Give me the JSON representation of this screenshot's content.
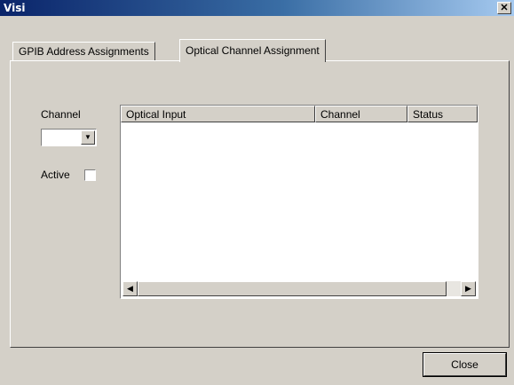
{
  "window": {
    "title": "Visi",
    "close_glyph": "✕"
  },
  "tabs": [
    {
      "label": "GPIB Address Assignments",
      "active": false
    },
    {
      "label": "Optical Channel Assignment",
      "active": true
    }
  ],
  "form": {
    "channel_label": "Channel",
    "channel_value": "",
    "active_label": "Active",
    "active_checked": false
  },
  "list": {
    "columns": [
      "Optical Input",
      "Channel",
      "Status"
    ],
    "rows": []
  },
  "footer": {
    "close_label": "Close"
  },
  "icons": {
    "dropdown": "caret-down-icon",
    "scroll_left": "arrow-left-icon",
    "scroll_right": "arrow-right-icon"
  }
}
